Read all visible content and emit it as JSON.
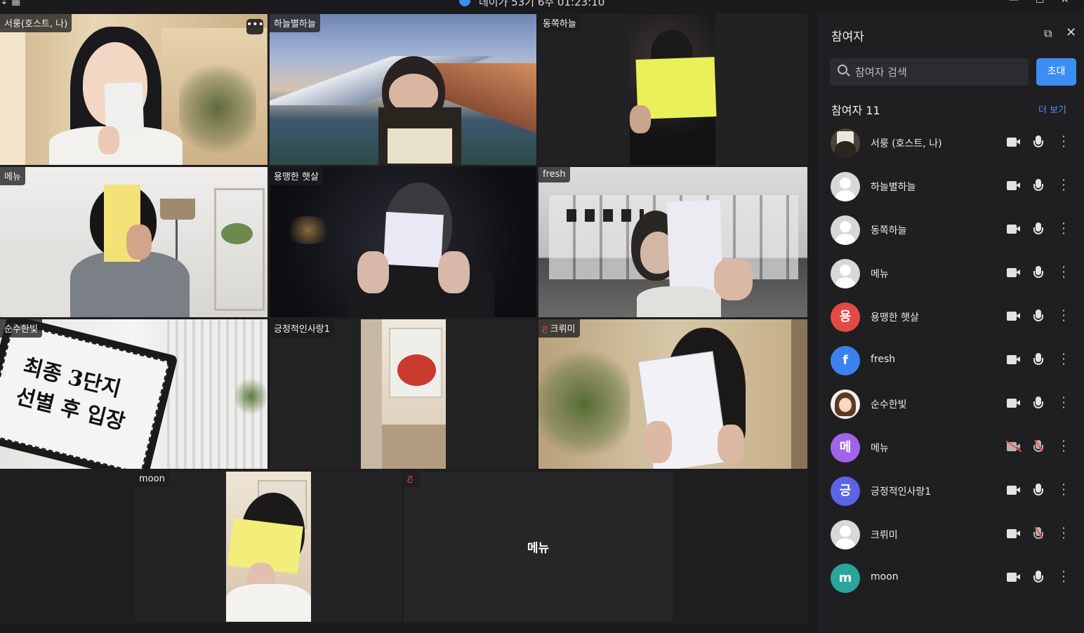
{
  "window": {
    "title": "데이가 53기 6주 01:23:10"
  },
  "tiles": [
    {
      "name": "서룽(호스트, 나)",
      "muted": false,
      "has_more_menu": true
    },
    {
      "name": "하늘별하늘",
      "muted": false
    },
    {
      "name": "동쪽하늘",
      "muted": false
    },
    {
      "name": "메뉴",
      "muted": false
    },
    {
      "name": "용맹한 햇살",
      "muted": false
    },
    {
      "name": "fresh",
      "muted": false
    },
    {
      "name": "순수한빛",
      "muted": false,
      "card_text": "최종 3단지 선별 후 입장"
    },
    {
      "name": "긍정적인사랑1",
      "muted": false
    },
    {
      "name": "크뤼미",
      "muted": true
    },
    {
      "name": "moon",
      "muted": false
    },
    {
      "name": "",
      "muted": true,
      "center_name": "메뉴"
    }
  ],
  "panel": {
    "title": "참여자",
    "search_placeholder": "참여자 검색",
    "invite_label": "초대",
    "count_label": "참여자 11",
    "more_view_label": "더 보기",
    "participants": [
      {
        "name": "서룽  (호스트, 나)",
        "avatar": "photo-sign",
        "cam": true,
        "mic": true
      },
      {
        "name": "하늘별하늘",
        "avatar": "default",
        "cam": true,
        "mic": true
      },
      {
        "name": "동쪽하늘",
        "avatar": "default",
        "cam": true,
        "mic": true
      },
      {
        "name": "메뉴",
        "avatar": "default",
        "cam": true,
        "mic": true
      },
      {
        "name": "용맹한 햇살",
        "avatar": "letter",
        "letter": "용",
        "color": "#e24a43",
        "cam": true,
        "mic": true
      },
      {
        "name": "fresh",
        "avatar": "letter",
        "letter": "f",
        "color": "#3a82ee",
        "cam": true,
        "mic": true
      },
      {
        "name": "순수한빛",
        "avatar": "photo-cartoon",
        "cam": true,
        "mic": true
      },
      {
        "name": "메뉴",
        "avatar": "letter",
        "letter": "메",
        "color": "#a163e8",
        "cam": false,
        "mic": false
      },
      {
        "name": "긍정적인사랑1",
        "avatar": "letter",
        "letter": "긍",
        "color": "#5b63e6",
        "cam": true,
        "mic": true
      },
      {
        "name": "크뤼미",
        "avatar": "default",
        "cam": true,
        "mic": false
      },
      {
        "name": "moon",
        "avatar": "letter",
        "letter": "m",
        "color": "#2aa59a",
        "cam": true,
        "mic": true
      }
    ]
  },
  "colors": {
    "accent": "#3d8ef2",
    "muted_red": "#ff4a4a",
    "panel_bg": "#1f1f22"
  }
}
